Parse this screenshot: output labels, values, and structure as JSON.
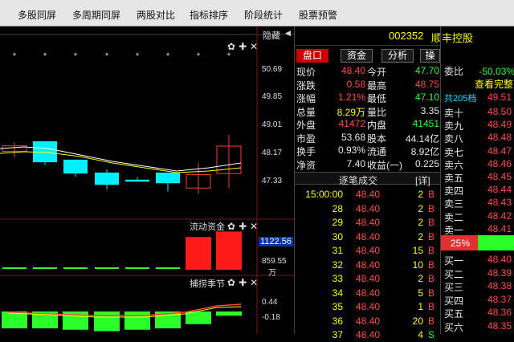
{
  "menu": [
    "多股同屏",
    "多周期同屏",
    "两股对比",
    "指标排序",
    "阶段统计",
    "股票预警"
  ],
  "hide_label": "隐藏",
  "stock": {
    "code": "002352",
    "name": "顺丰控股"
  },
  "tabs": [
    "盘口",
    "资金",
    "分析",
    "操作"
  ],
  "chart": {
    "price_labels": [
      "50.69",
      "49.85",
      "49.01",
      "48.17",
      "47.33"
    ],
    "mid_panel_title": "流动资金",
    "mid_labels": [
      "1122.56",
      "859.55"
    ],
    "mid_unit": "万",
    "bottom_panel_title": "捕捞季节",
    "bottom_labels": [
      "0.44",
      "-0.18"
    ],
    "stars": [
      "*",
      "*",
      "*",
      "*",
      "*",
      "*",
      "*",
      "*"
    ]
  },
  "chart_data": {
    "type": "candlestick",
    "candles": [
      {
        "open": 48.24,
        "close": 48.41,
        "high": 48.52,
        "low": 48.05
      },
      {
        "open": 48.55,
        "close": 47.9,
        "high": 48.55,
        "low": 47.82
      },
      {
        "open": 47.98,
        "close": 47.55,
        "high": 47.98,
        "low": 47.45
      },
      {
        "open": 47.58,
        "close": 47.2,
        "high": 47.68,
        "low": 47.05
      },
      {
        "open": 47.36,
        "close": 47.3,
        "high": 47.44,
        "low": 47.3
      },
      {
        "open": 47.58,
        "close": 47.25,
        "high": 47.58,
        "low": 47.0
      },
      {
        "open": 47.1,
        "close": 47.52,
        "high": 47.88,
        "low": 46.92
      },
      {
        "open": 47.55,
        "close": 48.4,
        "high": 48.75,
        "low": 47.1
      }
    ],
    "mid_bars": [
      -2,
      -2,
      -2,
      -2,
      -2,
      -2,
      60,
      70
    ],
    "bottom_bars": [
      -60,
      -60,
      -65,
      -70,
      -65,
      -60,
      -45,
      -15
    ]
  },
  "quote": [
    {
      "l1": "现价",
      "v1": "48.40",
      "c1": "r",
      "l2": "今开",
      "v2": "47.70",
      "c2": "g"
    },
    {
      "l1": "涨跌",
      "v1": "0.58",
      "c1": "r",
      "l2": "最高",
      "v2": "48.75",
      "c2": "r"
    },
    {
      "l1": "涨幅",
      "v1": "1.21%",
      "c1": "r",
      "l2": "最低",
      "v2": "47.10",
      "c2": "g"
    },
    {
      "l1": "总量",
      "v1": "8.29万",
      "c1": "y",
      "l2": "量比",
      "v2": "3.35",
      "c2": "w"
    },
    {
      "l1": "外盘",
      "v1": "41472",
      "c1": "r",
      "l2": "内盘",
      "v2": "41451",
      "c2": "g"
    },
    {
      "l1": "市盈",
      "v1": "53.68",
      "c1": "w",
      "l2": "股本",
      "v2": "44.14亿",
      "c2": "w"
    },
    {
      "l1": "换手",
      "v1": "0.93%",
      "c1": "w",
      "l2": "流通",
      "v2": "8.92亿",
      "c2": "w"
    },
    {
      "l1": "净资",
      "v1": "7.40",
      "c1": "w",
      "l2": "收益(一)",
      "v2": "0.225",
      "c2": "w"
    }
  ],
  "trades_title": "逐笔成交",
  "trades_detail": "[详]",
  "trades": [
    {
      "time": "15:00:00",
      "price": "48.40",
      "vol": "2",
      "side": "B"
    },
    {
      "time": "28",
      "price": "48.40",
      "vol": "2",
      "side": "B"
    },
    {
      "time": "29",
      "price": "48.40",
      "vol": "2",
      "side": "B"
    },
    {
      "time": "30",
      "price": "48.40",
      "vol": "2",
      "side": "B"
    },
    {
      "time": "31",
      "price": "48.40",
      "vol": "15",
      "side": "B"
    },
    {
      "time": "32",
      "price": "48.40",
      "vol": "10",
      "side": "B"
    },
    {
      "time": "33",
      "price": "48.40",
      "vol": "2",
      "side": "B"
    },
    {
      "time": "34",
      "price": "48.40",
      "vol": "5",
      "side": "B"
    },
    {
      "time": "35",
      "price": "48.40",
      "vol": "1",
      "side": "B"
    },
    {
      "time": "36",
      "price": "48.40",
      "vol": "20",
      "side": "B"
    },
    {
      "time": "37",
      "price": "48.40",
      "vol": "4",
      "side": "S"
    }
  ],
  "book": {
    "wb_label": "委比",
    "wb_value": "-50.03%",
    "wb_extra": "委差",
    "view_all": "查看完整",
    "total_label": "共205档",
    "total_price": "49.51",
    "asks": [
      [
        "卖十",
        "48.50"
      ],
      [
        "卖九",
        "48.49"
      ],
      [
        "卖八",
        "48.48"
      ],
      [
        "卖七",
        "48.47"
      ],
      [
        "卖六",
        "48.46"
      ],
      [
        "卖五",
        "48.45"
      ],
      [
        "卖四",
        "48.44"
      ],
      [
        "卖三",
        "48.43"
      ],
      [
        "卖二",
        "48.42"
      ],
      [
        "卖一",
        "48.41"
      ]
    ],
    "pct": "25%",
    "bids": [
      [
        "买一",
        "48.40"
      ],
      [
        "买二",
        "48.39"
      ],
      [
        "买三",
        "48.38"
      ],
      [
        "买四",
        "48.37"
      ],
      [
        "买五",
        "48.36"
      ],
      [
        "买六",
        "48.35"
      ]
    ]
  }
}
